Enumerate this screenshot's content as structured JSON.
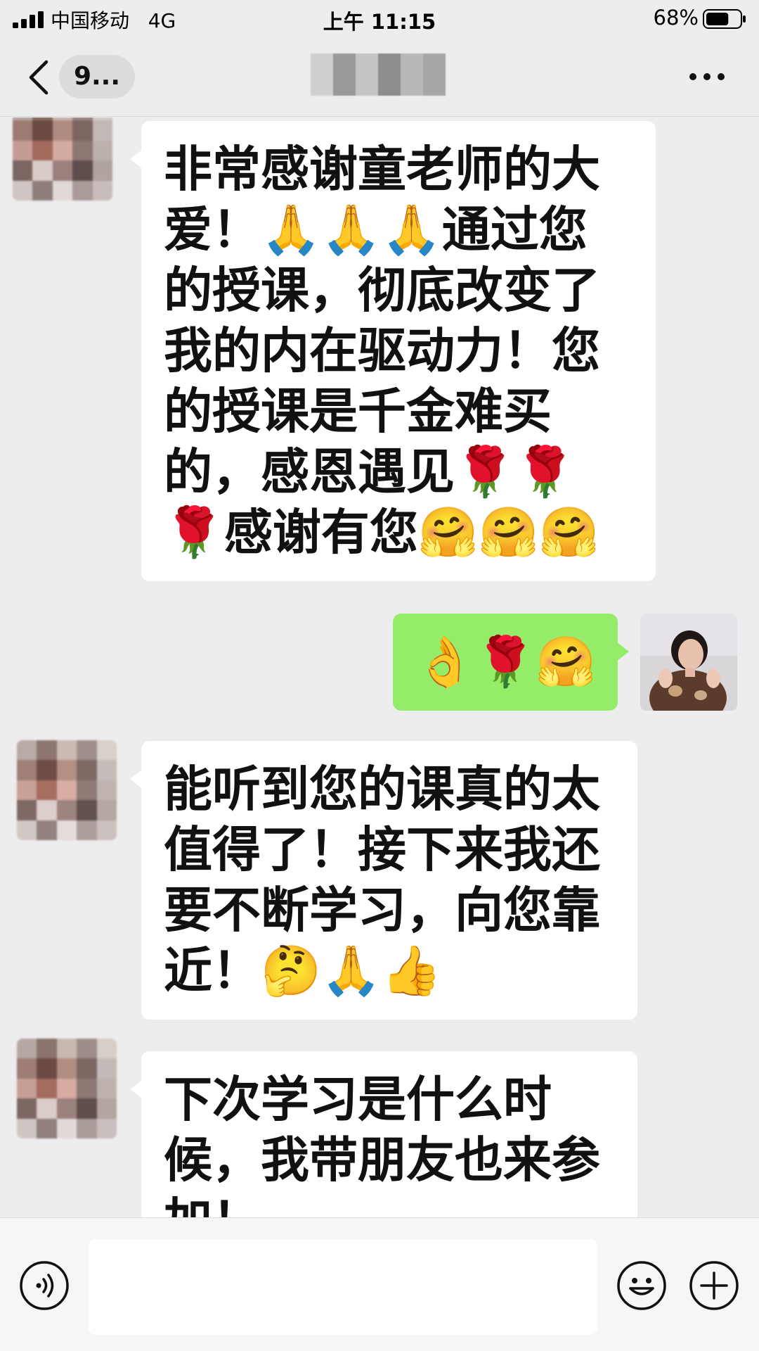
{
  "status_bar": {
    "carrier": "中国移动",
    "network": "4G",
    "time": "上午 11:15",
    "battery": "68%",
    "battery_level": 0.68
  },
  "nav": {
    "unread_label": "9...",
    "more_icon": "more-dots-icon",
    "back_icon": "chevron-left-icon"
  },
  "messages": [
    {
      "sender": "other",
      "text": "非常感谢童老师的大爱！🙏🙏🙏通过您的授课，彻底改变了我的内在驱动力！您的授课是千金难买的，感恩遇见🌹🌹🌹感谢有您🤗🤗🤗"
    },
    {
      "sender": "self",
      "text": "👌🌹🤗"
    },
    {
      "sender": "other",
      "text": "能听到您的课真的太值得了！接下来我还要不断学习，向您靠近！🤔🙏👍"
    },
    {
      "sender": "other",
      "text": "下次学习是什么时候，我带朋友也来参加！"
    }
  ],
  "input_bar": {
    "voice_icon": "voice-icon",
    "input_value": "",
    "emoji_icon": "emoji-smile-icon",
    "plus_icon": "plus-icon"
  },
  "colors": {
    "background": "#ededed",
    "bubble_self": "#95ec69",
    "bubble_other": "#ffffff"
  }
}
